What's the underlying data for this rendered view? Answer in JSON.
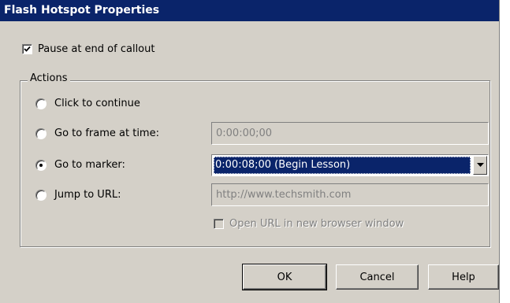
{
  "dialog": {
    "title": "Flash Hotspot Properties"
  },
  "pause": {
    "label": "Pause at end of callout",
    "checked": true
  },
  "actions": {
    "group_label": "Actions",
    "options": [
      {
        "label": "Click to continue",
        "selected": false
      },
      {
        "label": "Go to frame at time:",
        "selected": false
      },
      {
        "label": "Go to marker:",
        "selected": true
      },
      {
        "label": "Jump to URL:",
        "selected": false
      }
    ],
    "frame_time_value": "0:00:00;00",
    "marker_value": "0:00:08;00 (Begin Lesson)",
    "url_value": "http://www.techsmith.com",
    "open_new_window": {
      "label": "Open URL in new browser window",
      "checked": false,
      "enabled": false
    }
  },
  "buttons": {
    "ok": "OK",
    "cancel": "Cancel",
    "help": "Help"
  },
  "colors": {
    "titlebar": "#0a246a",
    "face": "#d4d0c8",
    "selection": "#0a246a"
  },
  "icons": {
    "checkbox_check": "check-icon",
    "combo_arrow": "dropdown-arrow-icon"
  }
}
